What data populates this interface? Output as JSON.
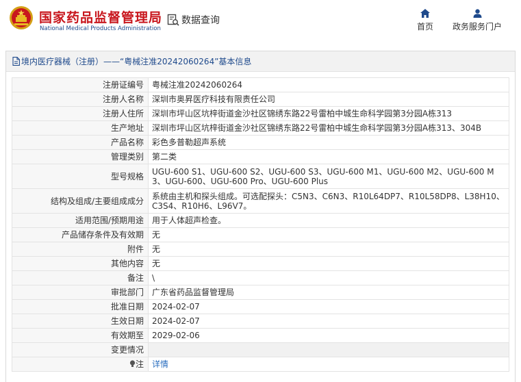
{
  "header": {
    "brand_cn": "国家药品监督管理局",
    "brand_en": "National Medical Products Administration",
    "search_label": "数据查询",
    "nav": {
      "home_label": "首页",
      "portal_label": "政务服务门户"
    }
  },
  "panel": {
    "title": "境内医疗器械（注册）——“粤械注准20242060264”基本信息"
  },
  "record": {
    "rows": [
      {
        "label": "注册证编号",
        "value": "粤械注准20242060264"
      },
      {
        "label": "注册人名称",
        "value": "深圳市奥昇医疗科技有限责任公司"
      },
      {
        "label": "注册人住所",
        "value": "深圳市坪山区坑梓街道金沙社区锦绣东路22号雷柏中城生命科学园第3分园A栋313"
      },
      {
        "label": "生产地址",
        "value": "深圳市坪山区坑梓街道金沙社区锦绣东路22号雷柏中城生命科学园第3分园A栋313、304B"
      },
      {
        "label": "产品名称",
        "value": "彩色多普勒超声系统"
      },
      {
        "label": "管理类别",
        "value": "第二类"
      },
      {
        "label": "型号规格",
        "value": "UGU-600 S1、UGU-600 S2、UGU-600 S3、UGU-600 M1、UGU-600 M2、UGU-600 M3、UGU-600、UGU-600 Pro、UGU-600 Plus"
      },
      {
        "label": "结构及组成/主要组成成分",
        "value": "系统由主机和探头组成。可选配探头：C5N3、C6N3、R10L64DP7、R10L58DP8、L38H10、C3S4、R10H6、L96V7。"
      },
      {
        "label": "适用范围/预期用途",
        "value": "用于人体超声检查。"
      },
      {
        "label": "产品储存条件及有效期",
        "value": "无"
      },
      {
        "label": "附件",
        "value": "无"
      },
      {
        "label": "其他内容",
        "value": "无"
      },
      {
        "label": "备注",
        "value": "\\"
      },
      {
        "label": "审批部门",
        "value": "广东省药品监督管理局"
      },
      {
        "label": "批准日期",
        "value": "2024-02-07"
      },
      {
        "label": "生效日期",
        "value": "2024-02-07"
      },
      {
        "label": "有效期至",
        "value": "2029-02-06"
      },
      {
        "label": "变更情况",
        "value": ""
      }
    ],
    "note": {
      "label": "注",
      "link": "详情"
    }
  },
  "icons": {
    "emblem": "national-emblem-icon",
    "search": "data-search-icon",
    "home": "home-icon",
    "portal": "user-icon",
    "panel": "document-icon",
    "note": "lightbulb-icon"
  },
  "colors": {
    "brand_red": "#c8161d",
    "brand_blue": "#1f4a8c",
    "link": "#2a6ebf",
    "row_shade": "#f1f1f1"
  }
}
